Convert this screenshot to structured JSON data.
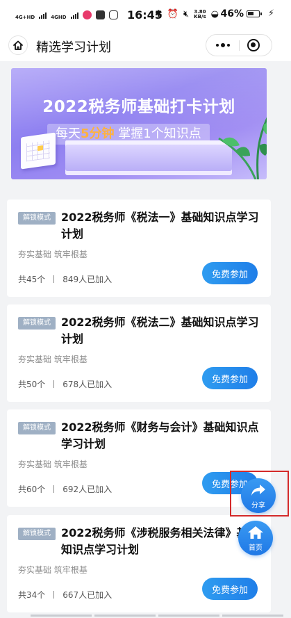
{
  "status_bar": {
    "signal1": "4G+HD",
    "signal2": "4GHD",
    "time": "16:45",
    "speed_value": "3.80",
    "speed_unit": "KB/s",
    "battery": "46%"
  },
  "nav": {
    "title": "精选学习计划"
  },
  "banner": {
    "title": "2022税务师基础打卡计划",
    "sub_prefix": "每天",
    "sub_highlight": "5分钟",
    "sub_suffix": " 掌握1个知识点",
    "accent": "#ffb23f"
  },
  "courses": [
    {
      "badge": "解锁模式",
      "title": "2022税务师《税法一》基础知识点学习计划",
      "subtitle": "夯实基础 筑牢根基",
      "count": "共45个",
      "joined": "849人已加入",
      "button": "免费参加"
    },
    {
      "badge": "解锁模式",
      "title": "2022税务师《税法二》基础知识点学习计划",
      "subtitle": "夯实基础 筑牢根基",
      "count": "共50个",
      "joined": "678人已加入",
      "button": "免费参加"
    },
    {
      "badge": "解锁模式",
      "title": "2022税务师《财务与会计》基础知识点学习计划",
      "subtitle": "夯实基础 筑牢根基",
      "count": "共60个",
      "joined": "692人已加入",
      "button": "免费参加"
    },
    {
      "badge": "解锁模式",
      "title": "2022税务师《涉税服务相关法律》基础知识点学习计划",
      "subtitle": "夯实基础 筑牢根基",
      "count": "共34个",
      "joined": "667人已加入",
      "button": "免费参加"
    }
  ],
  "floating": {
    "share_label": "分享",
    "home_label": "首页"
  },
  "colors": {
    "primary_blue": "#1f7ee8",
    "badge_gray": "#9fb0c4",
    "highlight_red": "#d42a2a"
  }
}
